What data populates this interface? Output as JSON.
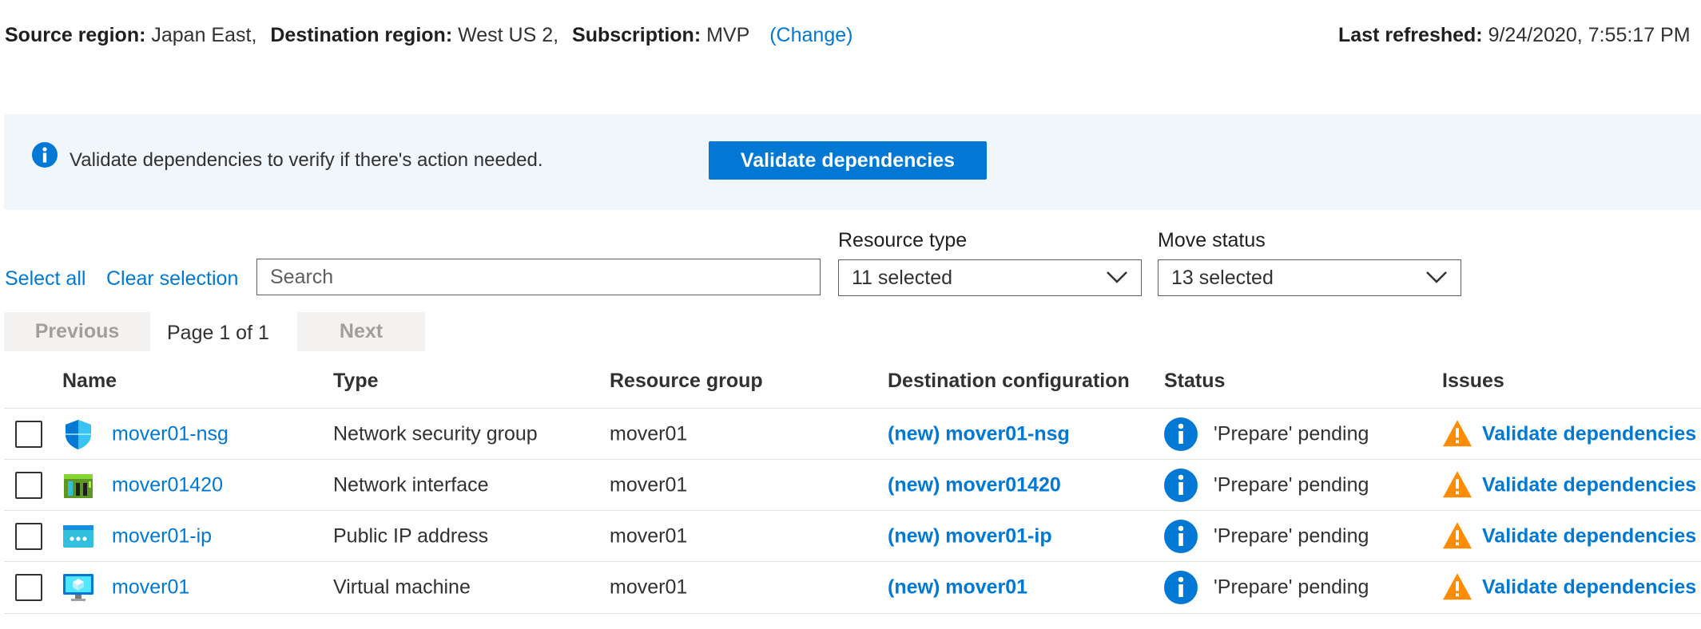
{
  "header": {
    "source_label": "Source region:",
    "source_value": "Japan East,",
    "destination_label": "Destination region:",
    "destination_value": "West US 2,",
    "subscription_label": "Subscription:",
    "subscription_value": "MVP",
    "change_link": "(Change)",
    "last_refreshed_label": "Last refreshed:",
    "last_refreshed_value": "9/24/2020, 7:55:17 PM"
  },
  "banner": {
    "message": "Validate dependencies to verify if there's action needed.",
    "button_label": "Validate dependencies",
    "background_color": "#eff6fc",
    "accent_color": "#0078d4"
  },
  "filters": {
    "select_all": "Select all",
    "clear_selection": "Clear selection",
    "search_placeholder": "Search",
    "resource_type_label": "Resource type",
    "resource_type_value": "11 selected",
    "move_status_label": "Move status",
    "move_status_value": "13 selected"
  },
  "pagination": {
    "previous": "Previous",
    "page_indicator": "Page 1 of 1",
    "next": "Next"
  },
  "table": {
    "columns": [
      "Name",
      "Type",
      "Resource group",
      "Destination configuration",
      "Status",
      "Issues"
    ],
    "rows": [
      {
        "icon": "network-security-group-icon",
        "name": "mover01-nsg",
        "type": "Network security group",
        "resource_group": "mover01",
        "destination": "(new) mover01-nsg",
        "status": "'Prepare' pending",
        "issue": "Validate dependencies"
      },
      {
        "icon": "network-interface-icon",
        "name": "mover01420",
        "type": "Network interface",
        "resource_group": "mover01",
        "destination": "(new) mover01420",
        "status": "'Prepare' pending",
        "issue": "Validate dependencies"
      },
      {
        "icon": "public-ip-address-icon",
        "name": "mover01-ip",
        "type": "Public IP address",
        "resource_group": "mover01",
        "destination": "(new) mover01-ip",
        "status": "'Prepare' pending",
        "issue": "Validate dependencies"
      },
      {
        "icon": "virtual-machine-icon",
        "name": "mover01",
        "type": "Virtual machine",
        "resource_group": "mover01",
        "destination": "(new) mover01",
        "status": "'Prepare' pending",
        "issue": "Validate dependencies"
      }
    ]
  },
  "colors": {
    "link": "#0078d4",
    "warning": "#ff8c00",
    "border": "#e1dfdd"
  }
}
